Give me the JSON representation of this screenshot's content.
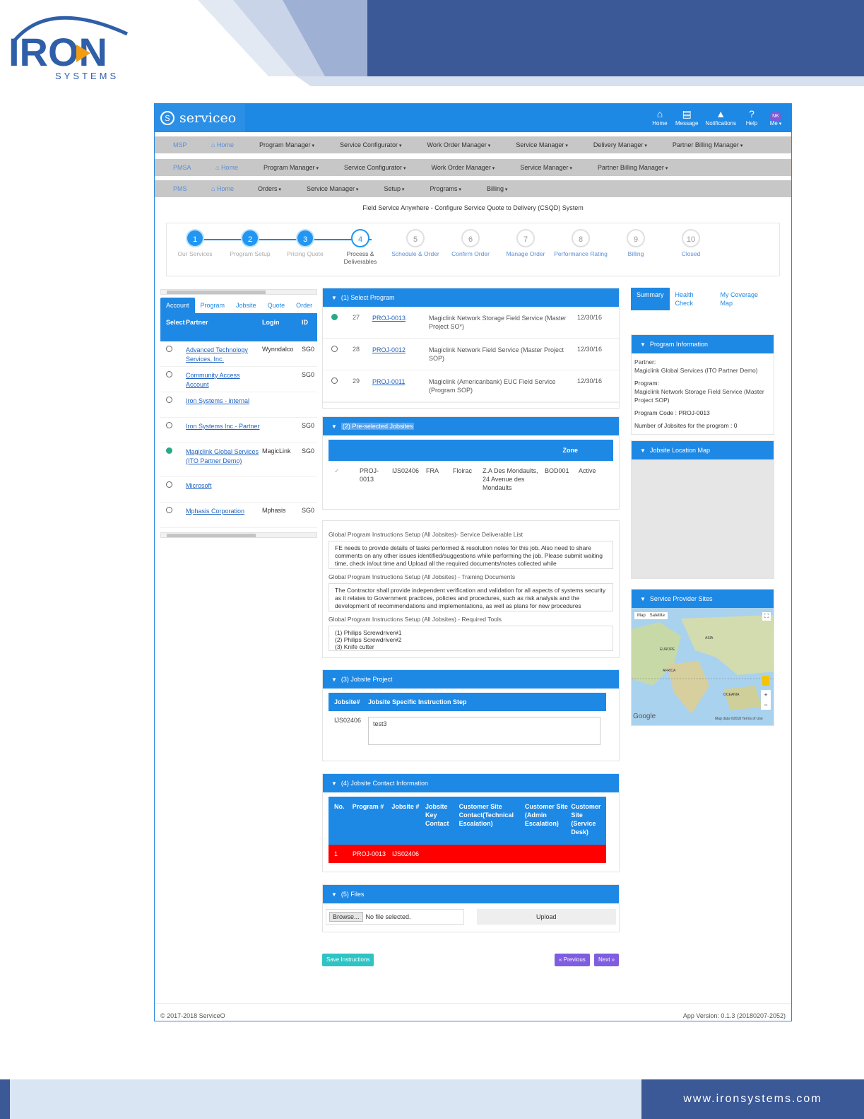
{
  "brand": {
    "company": "IRON",
    "sub": "SYSTEMS",
    "website": "www.ironsystems.com"
  },
  "app": {
    "name": "serviceo",
    "top_icons": [
      {
        "icon": "home-icon",
        "glyph": "⌂",
        "label": "Home"
      },
      {
        "icon": "message-icon",
        "glyph": "▤",
        "label": "Message"
      },
      {
        "icon": "bell-icon",
        "glyph": "🔔",
        "label": "Notifications"
      },
      {
        "icon": "help-icon",
        "glyph": "?",
        "label": "Help"
      }
    ],
    "user_initials": "NK",
    "user_label": "Me"
  },
  "nav": {
    "msp": {
      "module": "MSP",
      "items": [
        "Home",
        "Program Manager",
        "Service Configurator",
        "Work Order Manager",
        "Service Manager",
        "Delivery Manager",
        "Partner Billing Manager"
      ]
    },
    "pmsa": {
      "module": "PMSA",
      "items": [
        "Home",
        "Program Manager",
        "Service Configurator",
        "Work Order Manager",
        "Service Manager",
        "Partner Billing Manager"
      ]
    },
    "pms": {
      "module": "PMS",
      "items": [
        "Home",
        "Orders",
        "Service Manager",
        "Setup",
        "Programs",
        "Billing"
      ]
    }
  },
  "system_title": "Field Service Anywhere - Configure Service Quote to Delivery (CSQD) System",
  "steps": [
    {
      "n": "1",
      "label": "Our Services"
    },
    {
      "n": "2",
      "label": "Program Setup"
    },
    {
      "n": "3",
      "label": "Pricing Quote"
    },
    {
      "n": "4",
      "label": "Process & Deliverables"
    },
    {
      "n": "5",
      "label": "Schedule & Order"
    },
    {
      "n": "6",
      "label": "Confirm Order"
    },
    {
      "n": "7",
      "label": "Manage Order"
    },
    {
      "n": "8",
      "label": "Performance Rating"
    },
    {
      "n": "9",
      "label": "Billing"
    },
    {
      "n": "10",
      "label": "Closed"
    }
  ],
  "account_panel": {
    "tabs": [
      "Account",
      "Program",
      "Jobsite",
      "Quote",
      "Order"
    ],
    "headers": [
      "Select",
      "Partner",
      "Login",
      "ID"
    ],
    "rows": [
      {
        "partner": "Advanced Technology Services, Inc.",
        "login": "Wynndalco",
        "id": "SG0",
        "selected": false
      },
      {
        "partner": "Community Access Account",
        "login": "",
        "id": "SG0",
        "selected": false
      },
      {
        "partner": "Iron Systems - internal",
        "login": "",
        "id": "",
        "selected": false
      },
      {
        "partner": "Iron Systems Inc.- Partner",
        "login": "",
        "id": "SG0",
        "selected": false
      },
      {
        "partner": "Magiclink Global Services (ITO Partner Demo)",
        "login": "MagicLink",
        "id": "SG0",
        "selected": true
      },
      {
        "partner": "Microsoft",
        "login": "",
        "id": "",
        "selected": false
      },
      {
        "partner": "Mphasis Corporation",
        "login": "Mphasis",
        "id": "SG0",
        "selected": false
      }
    ]
  },
  "select_program": {
    "title": "(1) Select Program",
    "rows": [
      {
        "num": "27",
        "code": "PROJ-0013",
        "desc": "Magiclink Network Storage Field Service (Master Project SO*)",
        "date": "12/30/16",
        "selected": true
      },
      {
        "num": "28",
        "code": "PROJ-0012",
        "desc": "Magiclink Network Field Service (Master Project SOP)",
        "date": "12/30/16",
        "selected": false
      },
      {
        "num": "29",
        "code": "PROJ-0011",
        "desc": "Magiclink (Americanbank) EUC Field Service (Program SOP)",
        "date": "12/30/16",
        "selected": false
      }
    ]
  },
  "jobsites": {
    "title": "(2) Pre-selected Jobsites",
    "zone_header": "Zone",
    "row": [
      "PROJ-0013",
      "IJS02406",
      "FRA",
      "Floirac",
      "Z.A Des Mondaults, 24 Avenue des Mondaults",
      "BOD001",
      "Active"
    ]
  },
  "global_instructions": {
    "deliverable_label": "Global Program Instructions Setup (All Jobsites)- Service Deliverable List",
    "deliverable_text": "FE needs to provide details of tasks performed & resolution notes for this job. Also need to share comments on any other issues identified/suggestions while performing the job. Please submit waiting time, check in/out time and Upload all the required documents/notes collected while",
    "training_label": "Global Program Instructions Setup (All Jobsites) - Training Documents",
    "training_text": "The Contractor shall provide independent verification and validation for all aspects of systems security as it relates to Government practices, policies and procedures, such as risk analysis and the development of recommendations and implementations, as well as plans for new procedures",
    "tools_label": "Global Program Instructions Setup (All Jobsites) - Required Tools",
    "tools": [
      "(1) Philips Screwdriver#1",
      "(2) Philips Screwdriver#2",
      "(3) Knife cutter"
    ]
  },
  "jobsite_project": {
    "title": "(3) Jobsite Project",
    "headers": [
      "Jobsite#",
      "Jobsite Specific Instruction Step"
    ],
    "row": {
      "jobsite": "IJS02406",
      "instruction": "test3"
    }
  },
  "contact_info": {
    "title": "(4) Jobsite Contact Information",
    "headers": [
      "No.",
      "Program #",
      "Jobsite #",
      "Jobsite Key Contact",
      "Customer Site Contact(Technical Escalation)",
      "Customer Site (Admin Escalation)",
      "Customer Site (Service Desk)"
    ],
    "row": [
      "1",
      "PROJ-0013",
      "IJS02406"
    ]
  },
  "files": {
    "title": "(5) Files",
    "browse": "Browse...",
    "no_file": "No file selected.",
    "upload": "Upload"
  },
  "buttons": {
    "save": "Save Instructions",
    "prev": "« Previous",
    "next": "Next »"
  },
  "right_panel": {
    "tabs": [
      "Summary",
      "Health Check",
      "My Coverage Map"
    ],
    "program_info_title": "Program Information",
    "partner_label": "Partner:",
    "partner_value": "Magiclink Global Services (ITO Partner Demo)",
    "program_label": "Program:",
    "program_value": "Magiclink Network Storage Field Service (Master Project SOP)",
    "code_label": "Program Code :",
    "code_value": "PROJ-0013",
    "jobsites_label": "Number of Jobsites for the program :",
    "jobsites_value": "0",
    "map_title": "Jobsite Location Map",
    "sites_title": "Service Provider Sites",
    "map_tabs": [
      "Map",
      "Satellite"
    ],
    "google": "Google",
    "map_credit": "Map data ©2018   Terms of Use",
    "labels": [
      "ASIA",
      "EUROPE",
      "AFRICA",
      "OCEANIA"
    ]
  },
  "footer": {
    "copyright": "© 2017-2018 ServiceO",
    "version": "App Version: 0.1.3 (20180207-2052)"
  },
  "colors": {
    "primary": "#1e88e5",
    "header_band": "#3b5897",
    "nav_gray": "#c7c7c7",
    "red_row": "#ff0000",
    "save_btn": "#2ec4c4",
    "nav_btn": "#7e5de0"
  }
}
